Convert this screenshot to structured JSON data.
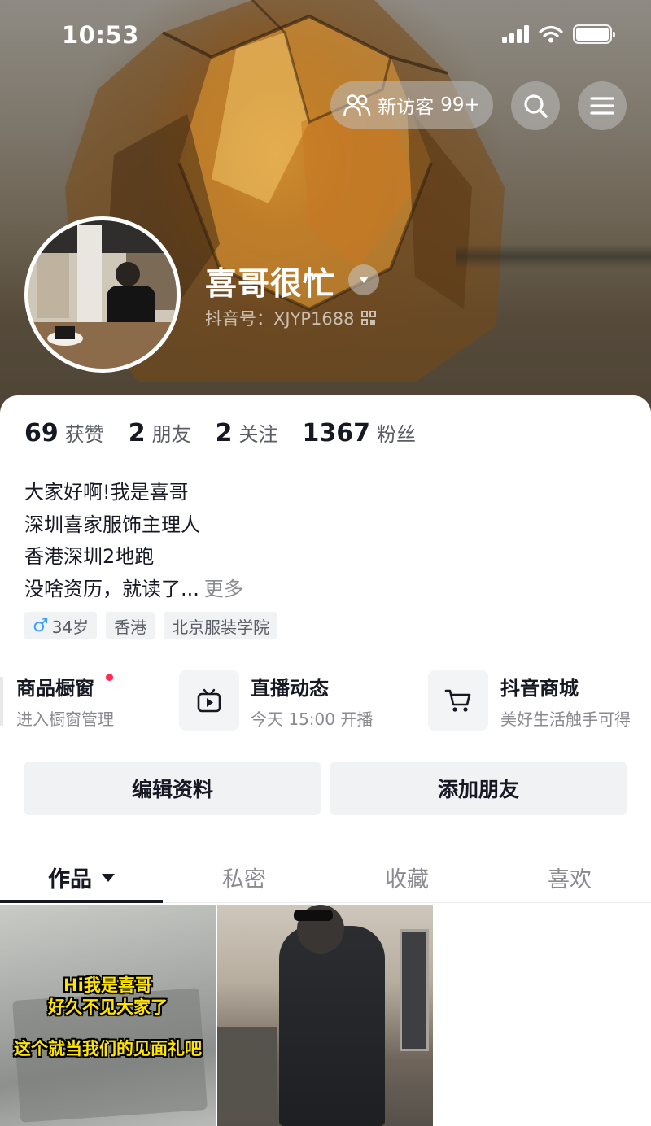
{
  "status_bar": {
    "time": "10:53"
  },
  "header": {
    "visitors_label": "新访客",
    "visitors_count": "99+",
    "nickname": "喜哥很忙",
    "douyin_id_label": "抖音号：",
    "douyin_id": "XJYP1688"
  },
  "stats": [
    {
      "value": "69",
      "label": "获赞"
    },
    {
      "value": "2",
      "label": "朋友"
    },
    {
      "value": "2",
      "label": "关注"
    },
    {
      "value": "1367",
      "label": "粉丝"
    }
  ],
  "bio": {
    "lines": [
      "大家好啊!我是喜哥",
      "深圳喜家服饰主理人",
      "香港深圳2地跑",
      "没啥资历，就读了..."
    ],
    "more": "更多"
  },
  "tags": {
    "gender_symbol": "♂",
    "age": "34岁",
    "region": "香港",
    "school": "北京服装学院"
  },
  "features": {
    "shop": {
      "title": "商品橱窗",
      "subtitle": "进入橱窗管理"
    },
    "live": {
      "title": "直播动态",
      "subtitle": "今天 15:00 开播"
    },
    "mall": {
      "title": "抖音商城",
      "subtitle": "美好生活触手可得"
    }
  },
  "actions": {
    "edit": "编辑资料",
    "add_friend": "添加朋友"
  },
  "tabs": [
    {
      "label": "作品",
      "active": true
    },
    {
      "label": "私密",
      "active": false
    },
    {
      "label": "收藏",
      "active": false
    },
    {
      "label": "喜欢",
      "active": false
    }
  ],
  "videos": [
    {
      "caption_line1": "Hi我是喜哥",
      "caption_line2": "好久不见大家了",
      "caption_line3": "这个就当我们的见面礼吧"
    },
    {}
  ],
  "colors": {
    "accent": "#fe2c55",
    "text": "#161823",
    "secondary": "#8a8b91",
    "chip_bg": "#f1f2f4",
    "male": "#3aa0ff"
  }
}
